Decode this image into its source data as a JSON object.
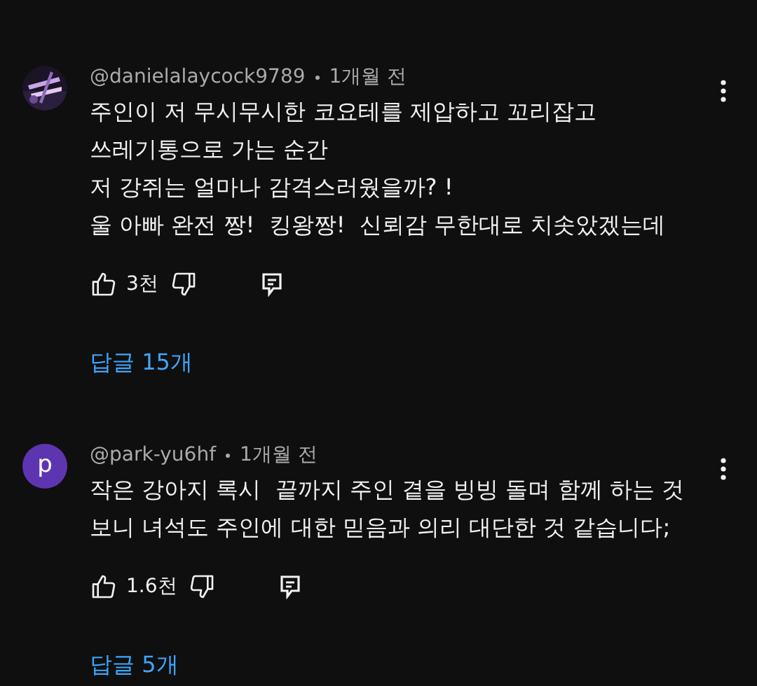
{
  "comments": [
    {
      "author": "@danielalaycock9789",
      "time": "1개월 전",
      "text": "주인이 저 무시무시한 코요테를 제압하고 꼬리잡고\n쓰레기통으로 가는 순간\n저 강쥐는 얼마나 감격스러웠을까? !\n울 아빠 완전 짱!  킹왕짱!  신뢰감 무한대로 치솟았겠는데",
      "likes": "3천",
      "replies": "답글 15개"
    },
    {
      "avatar": {
        "kind": "letter",
        "letter": "p",
        "color": "#5e35b1"
      },
      "author": "@park-yu6hf",
      "time": "1개월 전",
      "text": "작은 강아지 록시  끝까지 주인 곁을 빙빙 돌며 함께 하는 것\n보니 녀석도 주인에 대한 믿음과 의리 대단한 것 같습니다;",
      "likes": "1.6천",
      "replies": "답글 5개"
    }
  ]
}
